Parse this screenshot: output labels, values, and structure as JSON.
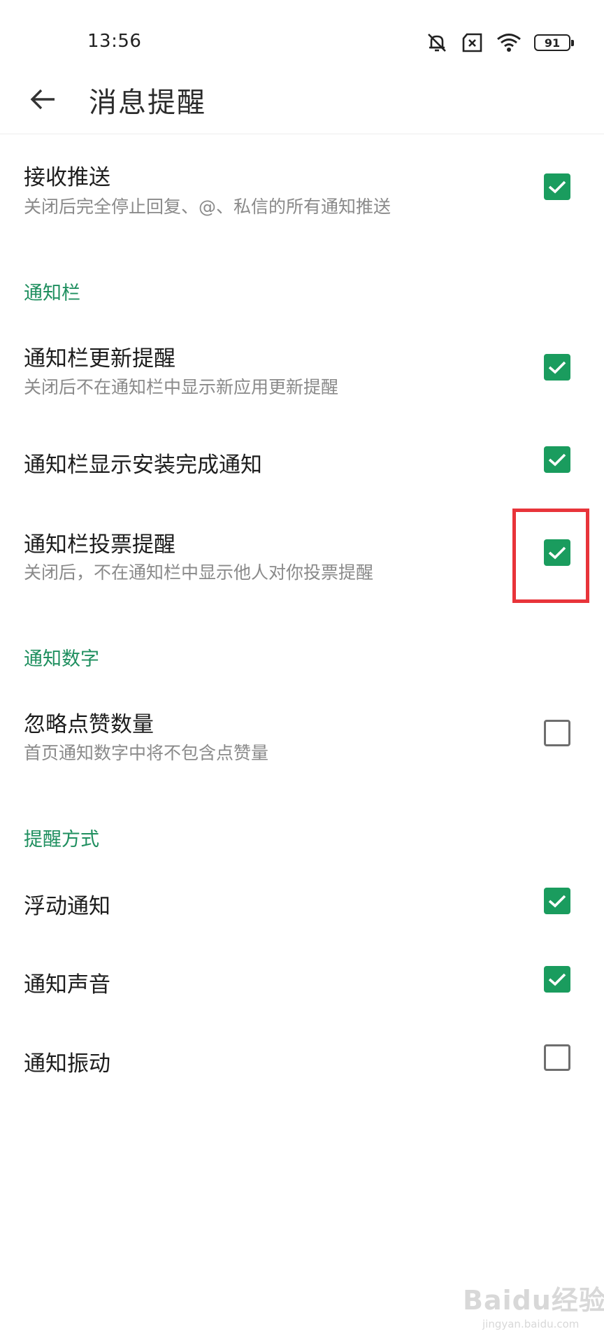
{
  "status_bar": {
    "time": "13:56",
    "battery": "91",
    "icons": [
      "mute-icon",
      "no-sim-icon",
      "wifi-icon",
      "battery-icon"
    ]
  },
  "app_bar": {
    "back_icon": "arrow-left-icon",
    "title": "消息提醒"
  },
  "settings": {
    "receive_push": {
      "title": "接收推送",
      "description": "关闭后完全停止回复、@、私信的所有通知推送",
      "checked": true
    },
    "sections": [
      {
        "header": "通知栏",
        "items": [
          {
            "title": "通知栏更新提醒",
            "description": "关闭后不在通知栏中显示新应用更新提醒",
            "checked": true
          },
          {
            "title": "通知栏显示安装完成通知",
            "checked": true
          },
          {
            "title": "通知栏投票提醒",
            "description": "关闭后，不在通知栏中显示他人对你投票提醒",
            "checked": true,
            "highlighted": true
          }
        ]
      },
      {
        "header": "通知数字",
        "items": [
          {
            "title": "忽略点赞数量",
            "description": "首页通知数字中将不包含点赞量",
            "checked": false
          }
        ]
      },
      {
        "header": "提醒方式",
        "items": [
          {
            "title": "浮动通知",
            "checked": true
          },
          {
            "title": "通知声音",
            "checked": true
          },
          {
            "title": "通知振动",
            "checked": false
          }
        ]
      }
    ]
  },
  "watermark": {
    "brand": "Baidu经验",
    "url": "jingyan.baidu.com"
  },
  "colors": {
    "accent": "#1a9c5e",
    "section_header": "#1f8f5f",
    "highlight": "#e8343a"
  }
}
